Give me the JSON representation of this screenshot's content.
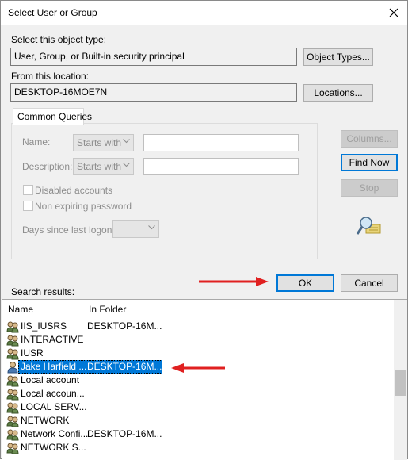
{
  "window": {
    "title": "Select User or Group"
  },
  "object_type": {
    "label": "Select this object type:",
    "value": "User, Group, or Built-in security principal",
    "button": "Object Types..."
  },
  "location": {
    "label": "From this location:",
    "value": "DESKTOP-16MOE7N",
    "button": "Locations..."
  },
  "common_queries": {
    "tab_label": "Common Queries",
    "name_label": "Name:",
    "name_combo": "Starts with",
    "description_label": "Description:",
    "description_combo": "Starts with",
    "disabled_accounts": "Disabled accounts",
    "non_expiring": "Non expiring password",
    "days_label": "Days since last logon:",
    "days_value": ""
  },
  "actions": {
    "columns": "Columns...",
    "find_now": "Find Now",
    "stop": "Stop"
  },
  "footer": {
    "search_results_label": "Search results:",
    "ok": "OK",
    "cancel": "Cancel"
  },
  "results": {
    "columns": [
      "Name",
      "In Folder"
    ],
    "rows": [
      {
        "name": "IIS_IUSRS",
        "folder": "DESKTOP-16M...",
        "icon": "group-icon"
      },
      {
        "name": "INTERACTIVE",
        "folder": "",
        "icon": "group-icon"
      },
      {
        "name": "IUSR",
        "folder": "",
        "icon": "group-icon"
      },
      {
        "name": "Jake Harfield ...",
        "folder": "DESKTOP-16M...",
        "icon": "user-icon",
        "selected": true
      },
      {
        "name": "Local account",
        "folder": "",
        "icon": "group-icon"
      },
      {
        "name": "Local accoun...",
        "folder": "",
        "icon": "group-icon"
      },
      {
        "name": "LOCAL SERV...",
        "folder": "",
        "icon": "group-icon"
      },
      {
        "name": "NETWORK",
        "folder": "",
        "icon": "group-icon"
      },
      {
        "name": "Network Confi...",
        "folder": "DESKTOP-16M...",
        "icon": "group-icon"
      },
      {
        "name": "NETWORK S...",
        "folder": "",
        "icon": "group-icon"
      }
    ]
  },
  "colors": {
    "selection": "#0078d7",
    "annotation_arrow": "#e02020"
  }
}
